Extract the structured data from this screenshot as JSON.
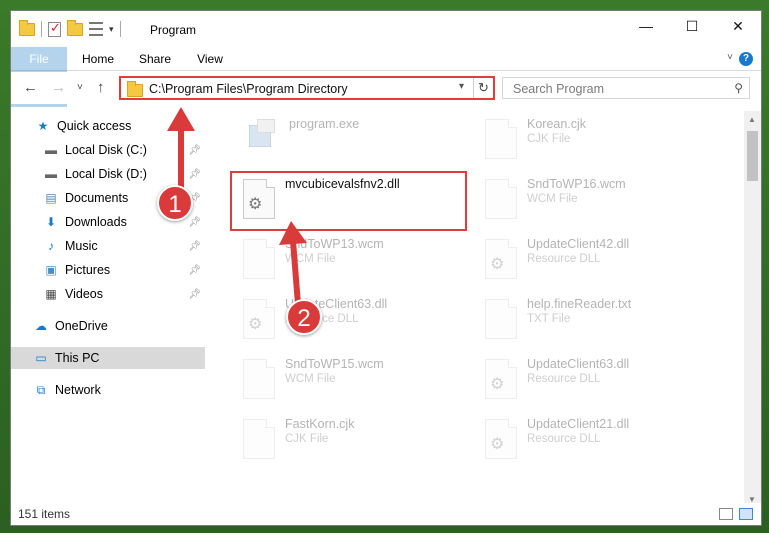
{
  "window": {
    "title": "Program",
    "controls": {
      "minimize": "—",
      "maximize": "☐",
      "close": "✕"
    }
  },
  "ribbon": {
    "tabs": [
      {
        "label": "File"
      },
      {
        "label": "Home"
      },
      {
        "label": "Share"
      },
      {
        "label": "View"
      }
    ],
    "help": "?"
  },
  "navigation": {
    "back": "←",
    "forward": "→",
    "recent": "˅",
    "up": "↑",
    "address": "C:\\Program Files\\Program Directory",
    "search_placeholder": "Search Program"
  },
  "sidebar": {
    "items": [
      {
        "label": "Quick access",
        "icon": "star-icon",
        "pinned": false
      },
      {
        "label": "Local Disk (C:)",
        "icon": "drive-icon",
        "pinned": true
      },
      {
        "label": "Local Disk (D:)",
        "icon": "drive-icon",
        "pinned": true
      },
      {
        "label": "Documents",
        "icon": "documents-icon",
        "pinned": true
      },
      {
        "label": "Downloads",
        "icon": "download-icon",
        "pinned": true
      },
      {
        "label": "Music",
        "icon": "music-icon",
        "pinned": true
      },
      {
        "label": "Pictures",
        "icon": "pictures-icon",
        "pinned": true
      },
      {
        "label": "Videos",
        "icon": "videos-icon",
        "pinned": true
      },
      {
        "label": "OneDrive",
        "icon": "cloud-icon",
        "pinned": false
      },
      {
        "label": "This PC",
        "icon": "pc-icon",
        "pinned": false,
        "selected": true
      },
      {
        "label": "Network",
        "icon": "network-icon",
        "pinned": false
      }
    ]
  },
  "files": [
    {
      "name": "program.exe",
      "type": "",
      "kind": "exe"
    },
    {
      "name": "Korean.cjk",
      "type": "CJK File",
      "kind": "doc"
    },
    {
      "name": "mvcubicevalsfnv2.dll",
      "type": "",
      "kind": "dll",
      "highlighted": true
    },
    {
      "name": "SndToWP16.wcm",
      "type": "WCM File",
      "kind": "doc"
    },
    {
      "name": "SndToWP13.wcm",
      "type": "WCM File",
      "kind": "doc"
    },
    {
      "name": "UpdateClient42.dll",
      "type": "Resource DLL",
      "kind": "dll"
    },
    {
      "name": "UpdateClient63.dll",
      "type": "Resource DLL",
      "kind": "dll"
    },
    {
      "name": "help.fineReader.txt",
      "type": "TXT File",
      "kind": "doc"
    },
    {
      "name": "SndToWP15.wcm",
      "type": "WCM File",
      "kind": "doc"
    },
    {
      "name": "UpdateClient63.dll",
      "type": "Resource DLL",
      "kind": "dll"
    },
    {
      "name": "FastKorn.cjk",
      "type": "CJK File",
      "kind": "doc"
    },
    {
      "name": "UpdateClient21.dll",
      "type": "Resource DLL",
      "kind": "dll"
    }
  ],
  "status": {
    "item_count": "151 items"
  },
  "annotations": [
    {
      "number": "1",
      "color": "#d93a3a"
    },
    {
      "number": "2",
      "color": "#d93a3a"
    }
  ],
  "colors": {
    "accent": "#1979ca",
    "highlight": "#e03c3c",
    "selected": "#d9d9d9"
  }
}
